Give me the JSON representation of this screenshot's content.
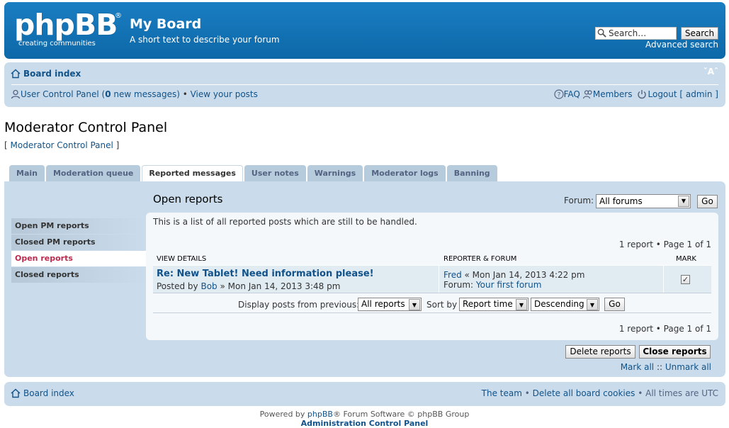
{
  "header": {
    "logo_text": "phpBB",
    "logo_reg": "®",
    "logo_tagline": "creating   communities",
    "site_title": "My Board",
    "site_description": "A short text to describe your forum",
    "search_placeholder": "Search…",
    "search_button": "Search",
    "advanced_search": "Advanced search"
  },
  "navbar": {
    "breadcrumb": "Board index",
    "font_size_toggle": "ˇAˆ",
    "ucp_label": "User Control Panel (",
    "new_messages_count": "0",
    "new_messages_suffix": " new messages)",
    "separator": " • ",
    "view_posts": "View your posts",
    "faq": "FAQ",
    "members": "Members",
    "logout": "Logout [ admin ]"
  },
  "page": {
    "title": "Moderator Control Panel",
    "mcp_link_open": "[ ",
    "mcp_link": "Moderator Control Panel",
    "mcp_link_close": " ]"
  },
  "tabs": [
    {
      "label": "Main",
      "active": false
    },
    {
      "label": "Moderation queue",
      "active": false
    },
    {
      "label": "Reported messages",
      "active": true
    },
    {
      "label": "User notes",
      "active": false
    },
    {
      "label": "Warnings",
      "active": false
    },
    {
      "label": "Moderator logs",
      "active": false
    },
    {
      "label": "Banning",
      "active": false
    }
  ],
  "side_menu": [
    {
      "label": "Open PM reports",
      "active": false
    },
    {
      "label": "Closed PM reports",
      "active": false
    },
    {
      "label": "Open reports",
      "active": true
    },
    {
      "label": "Closed reports",
      "active": false
    }
  ],
  "content": {
    "title": "Open reports",
    "forum_label": "Forum:",
    "forum_selected": "All forums",
    "go_button": "Go",
    "description": "This is a list of all reported posts which are still to be handled.",
    "pagination": "1 report • Page 1 of 1",
    "col_view_details": "VIEW DETAILS",
    "col_reporter_forum": "REPORTER & FORUM",
    "col_mark": "MARK",
    "report": {
      "post_title": "Re: New Tablet! Need information please!",
      "posted_by_prefix": "Posted by ",
      "author": "Bob",
      "post_date": " » Mon Jan 14, 2013 3:48 pm",
      "reporter": "Fred",
      "report_date": " « Mon Jan 14, 2013 4:22 pm",
      "forum_prefix": "Forum: ",
      "forum_name": "Your first forum",
      "marked": "✓"
    },
    "sort": {
      "display_label": "Display posts from previous:",
      "display_selected": "All reports",
      "sort_label": "Sort by",
      "sort_by_selected": "Report time",
      "order_selected": "Descending",
      "go_button": "Go"
    },
    "delete_button": "Delete reports",
    "close_button": "Close reports",
    "mark_all": "Mark all",
    "mark_sep": " :: ",
    "unmark_all": "Unmark all"
  },
  "footer": {
    "breadcrumb": "Board index",
    "team": "The team",
    "sep": " • ",
    "delete_cookies": "Delete all board cookies",
    "timezone": "All times are UTC",
    "powered_prefix": "Powered by ",
    "powered_link": "phpBB",
    "powered_suffix": "® Forum Software © phpBB Group",
    "acp_link": "Administration Control Panel"
  },
  "colors": {
    "header_blue": "#0d68a8",
    "panel_blue": "#cadceb",
    "link_blue": "#105289",
    "active_menu_red": "#bc2a4d"
  }
}
